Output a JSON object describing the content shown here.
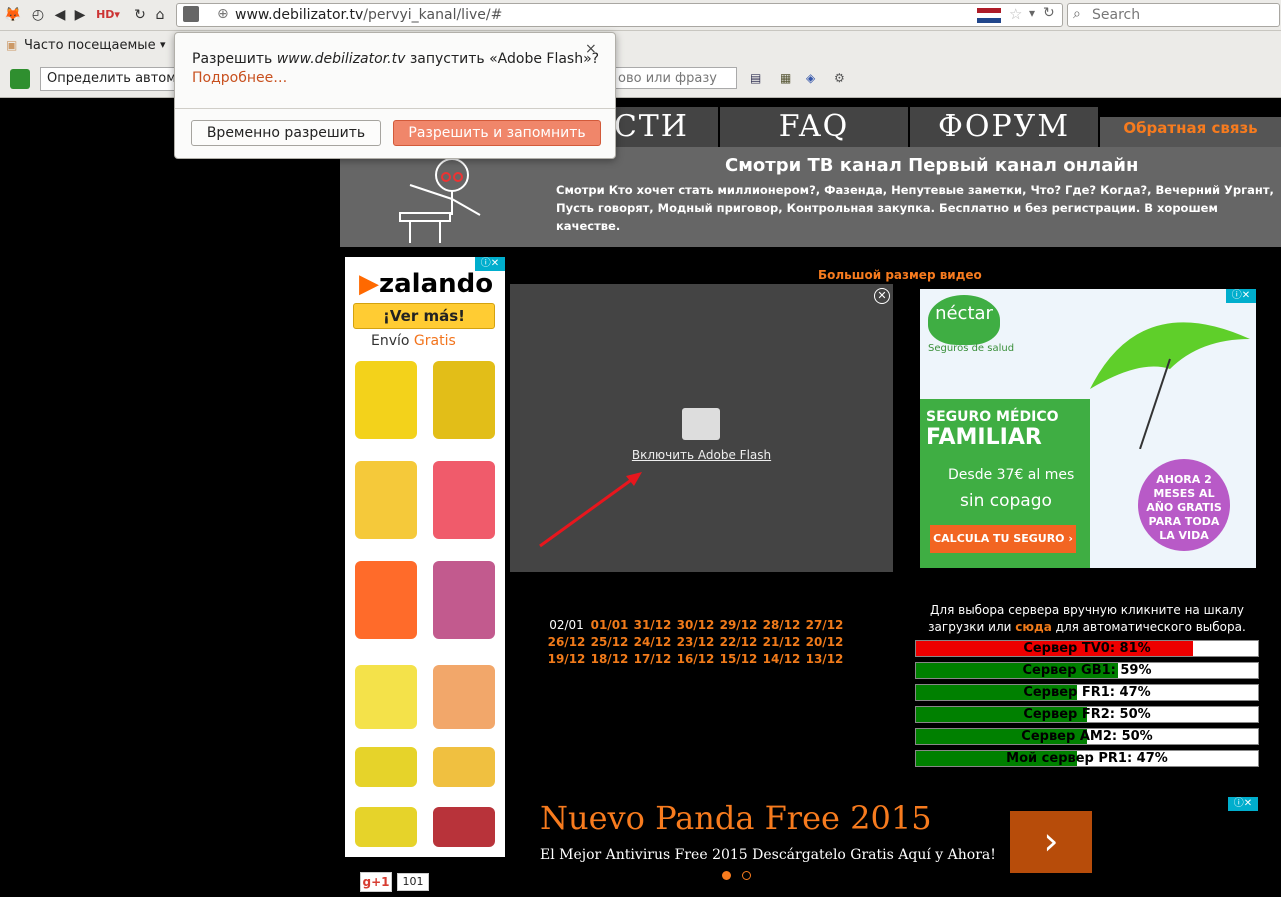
{
  "browser": {
    "url_host": "www.debilizator.tv",
    "url_path": "/pervyi_kanal/live/#",
    "search_placeholder": "Search",
    "bookmarks_label": "Часто посещаемые",
    "addon_label": "Определить автом",
    "addon_field": "ово или фразу"
  },
  "popup": {
    "message_prefix": "Разрешить ",
    "message_site": "www.debilizator.tv",
    "message_suffix": " запустить «Adobe Flash»?",
    "more_link": "Подробнее…",
    "close": "×",
    "btn_temp": "Временно разрешить",
    "btn_remember": "Разрешить и запомнить"
  },
  "site": {
    "menu": [
      "ОСТИ",
      "FAQ",
      "ФОРУМ"
    ],
    "feedback": "Обратная связь",
    "title": "Смотри ТВ канал Первый канал онлайн",
    "description": "Смотри Кто хочет стать миллионером?, Фазенда, Непутевые заметки, Что? Где? Когда?, Вечерний Ургант, Пусть говорят, Модный приговор, Контрольная закупка. Бесплатно и без регистрации. В хорошем качестве.",
    "video_size": "Большой размер видео",
    "plugin_link": "Включить Adobe Flash"
  },
  "dates": {
    "row1": [
      "02/01",
      "01/01",
      "31/12",
      "30/12",
      "29/12",
      "28/12",
      "27/12"
    ],
    "row2": [
      "26/12",
      "25/12",
      "24/12",
      "23/12",
      "22/12",
      "21/12",
      "20/12"
    ],
    "row3": [
      "19/12",
      "18/12",
      "17/12",
      "16/12",
      "15/12",
      "14/12",
      "13/12"
    ]
  },
  "servers": {
    "hint_a": "Для выбора сервера вручную кликните на шкалу загрузки или ",
    "hint_link": "сюда",
    "hint_b": " для автоматического выбора.",
    "items": [
      {
        "label": "Сервер TV0: 81%",
        "load": 0.81,
        "color": "#ee0000"
      },
      {
        "label": "Сервер GB1: 59%",
        "load": 0.59,
        "color": "#008000"
      },
      {
        "label": "Сервер FR1: 47%",
        "load": 0.47,
        "color": "#008000"
      },
      {
        "label": "Сервер FR2: 50%",
        "load": 0.5,
        "color": "#008000"
      },
      {
        "label": "Сервер AM2: 50%",
        "load": 0.5,
        "color": "#008000"
      },
      {
        "label": "Мой сервер PR1: 47%",
        "load": 0.47,
        "color": "#008000"
      }
    ]
  },
  "ads": {
    "zalando_logo": "zalando",
    "zalando_cta": "¡Ver más!",
    "zalando_envio": "Envío ",
    "zalando_gratis": "Gratis",
    "nectar_logo": "néctar",
    "nectar_sub": "Seguros de salud",
    "nectar_t1": "SEGURO MÉDICO",
    "nectar_t2": "FAMILIAR",
    "nectar_t3": "Desde 37€ al mes",
    "nectar_t4": "sin copago",
    "nectar_cta": "CALCULA TU SEGURO ›",
    "nectar_badge": "AHORA 2 MESES AL AÑO GRATIS PARA TODA LA VIDA",
    "panda_title": "Nuevo Panda Free 2015",
    "panda_desc": "El Mejor Antivirus Free 2015 Descárgatelo Gratis Aquí y Ahora!",
    "panda_go": "›",
    "gplus": "g+1",
    "gplus_count": "101"
  },
  "colors": {
    "accent": "#f77b1e",
    "popup_primary": "#f0866a"
  }
}
